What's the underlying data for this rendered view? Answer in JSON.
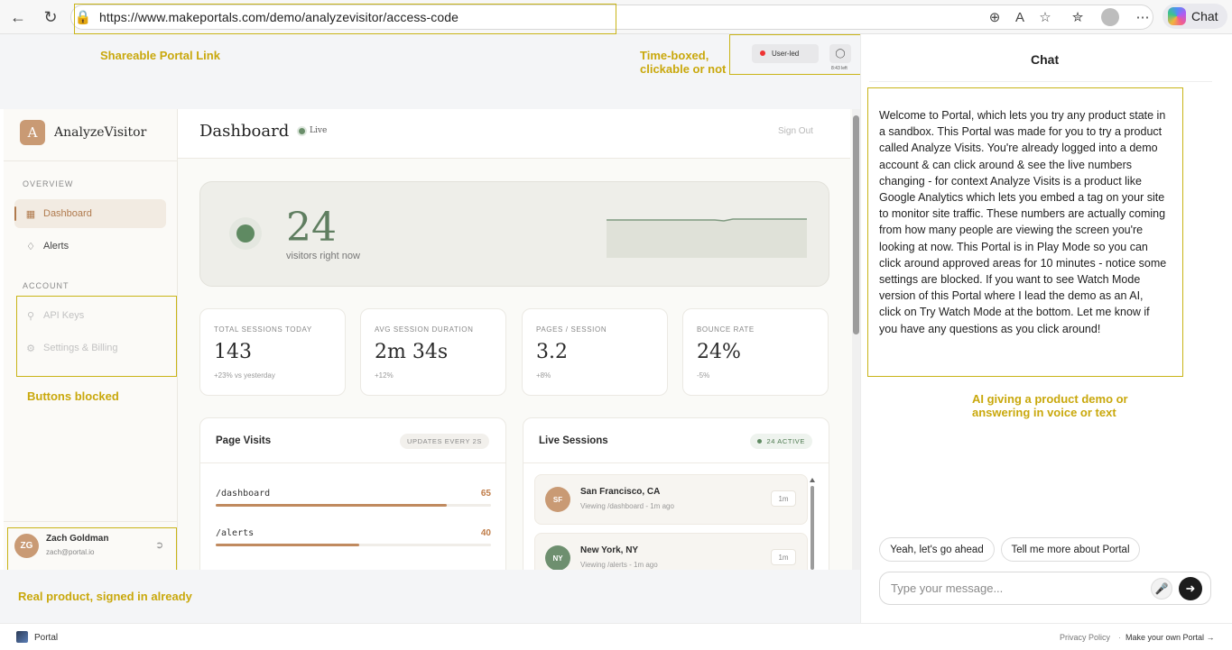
{
  "browser": {
    "url": "https://www.makeportals.com/demo/analyzevisitor/access-code",
    "chat_label": "Chat"
  },
  "annotations": {
    "shareable_link": "Shareable Portal Link",
    "time_boxed_line1": "Time-boxed,",
    "time_boxed_line2": "clickable or not",
    "buttons_blocked": "Buttons blocked",
    "real_product": "Real product, signed in already",
    "ai_demo_line1": "AI giving a product demo or",
    "ai_demo_line2": "answering in voice or text"
  },
  "mode": {
    "user_led_label": "User-led",
    "timer": "8:43 left"
  },
  "app": {
    "logo_letter": "A",
    "name": "AnalyzeVisitor",
    "sections": {
      "overview": "OVERVIEW",
      "account": "ACCOUNT"
    },
    "nav": {
      "dashboard": "Dashboard",
      "alerts": "Alerts",
      "api_keys": "API Keys",
      "settings": "Settings & Billing"
    },
    "user": {
      "initials": "ZG",
      "name": "Zach Goldman",
      "email": "zach@portal.io"
    },
    "header": {
      "title": "Dashboard",
      "status": "Live",
      "sign_out": "Sign Out"
    },
    "hero": {
      "value": "24",
      "label": "visitors right now"
    },
    "stats": [
      {
        "label": "TOTAL SESSIONS TODAY",
        "value": "143",
        "delta": "+23% vs yesterday"
      },
      {
        "label": "AVG SESSION DURATION",
        "value": "2m 34s",
        "delta": "+12%"
      },
      {
        "label": "PAGES / SESSION",
        "value": "3.2",
        "delta": "+8%"
      },
      {
        "label": "BOUNCE RATE",
        "value": "24%",
        "delta": "-5%"
      }
    ],
    "page_visits": {
      "title": "Page Visits",
      "badge": "UPDATES EVERY 2S",
      "rows": [
        {
          "path": "/dashboard",
          "count": "65",
          "fraction": 0.84
        },
        {
          "path": "/alerts",
          "count": "40",
          "fraction": 0.52
        }
      ]
    },
    "live_sessions": {
      "title": "Live Sessions",
      "badge": "24 ACTIVE",
      "items": [
        {
          "initials": "SF",
          "city": "San Francisco, CA",
          "sub": "Viewing /dashboard - 1m ago",
          "time": "1m",
          "color": "#c99a74"
        },
        {
          "initials": "NY",
          "city": "New York, NY",
          "sub": "Viewing /alerts - 1m ago",
          "time": "1m",
          "color": "#6e8f6f"
        }
      ]
    }
  },
  "chat": {
    "title": "Chat",
    "message": "Welcome to Portal, which lets you try any product state in a sandbox. This Portal was made for you to try a product called Analyze Visits. You're already logged into a demo account & can click around & see the live numbers changing - for context Analyze Visits is a product like Google Analytics which lets you embed a tag on your site to monitor site traffic. These numbers are actually coming from how many people are viewing the screen you're looking at now. This Portal is in Play Mode so you can click around approved areas for 10 minutes - notice some settings are blocked. If you want to see Watch Mode version of this Portal where I lead the demo as an AI, click on Try Watch Mode at the bottom. Let me know if you have any questions as you click around!",
    "suggestions": [
      "Yeah, let's go ahead",
      "Tell me more about Portal"
    ],
    "input_placeholder": "Type your message..."
  },
  "footer": {
    "brand": "Portal",
    "privacy": "Privacy Policy",
    "make_own": "Make your own Portal →"
  },
  "colors": {
    "accent": "#c99a74",
    "annotation": "#c9a80c",
    "live_green": "#5f8a62"
  }
}
